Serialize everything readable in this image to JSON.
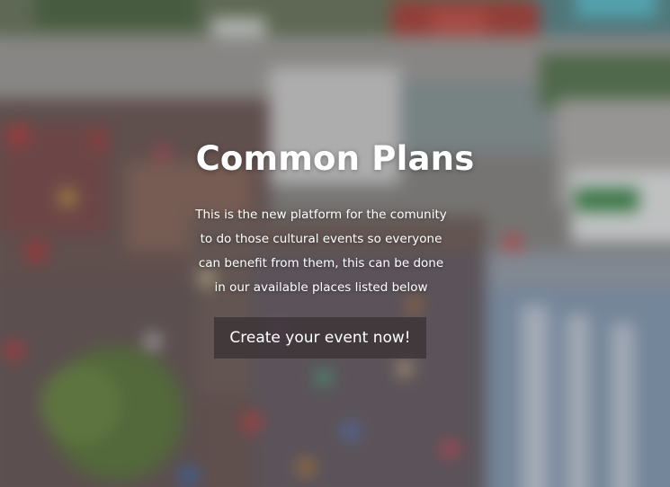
{
  "hero": {
    "title": "Common Plans",
    "description_lines": [
      "This is the new platform for the comunity",
      "to do those cultural events so everyone",
      "can benefit from them, this can be done",
      "in our available places listed below"
    ],
    "cta_label": "Create your event now!"
  },
  "colors": {
    "text": "#ffffff",
    "cta_background": "#3a3234"
  }
}
